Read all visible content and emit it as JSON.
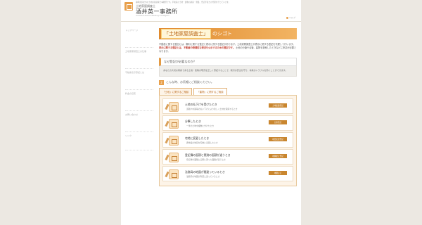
{
  "header": {
    "tagline": "静岡県浜松市の土地家屋調査士事務所です。不動産の土地・建物の調査・測量、登記手続きの代理を行っています。",
    "sub": "土地家屋調査士",
    "office_name": "酒井英一事務所",
    "office_en": "Licensed Land and Building Investigator",
    "help_label": "ヘルプ"
  },
  "sidebar": {
    "items": [
      {
        "label": "トップページ"
      },
      {
        "label": "土地家屋調査士の仕事"
      },
      {
        "label": "不動産表示登記とは"
      },
      {
        "label": "料金の目安"
      },
      {
        "label": "お問い合わせ"
      },
      {
        "label": "リンク"
      }
    ]
  },
  "main": {
    "title_highlight": "「土地家屋調査士」",
    "title_rest": "のシゴト",
    "intro": {
      "p1": "不動産に関する登記には、権利に関する登記と表示に関する登記があります。土地家屋調査士が表示に関する登記を代理して行います。",
      "p2_em": "表示に関する登記とは、不動産の物理的な現況を公示するための登記です。",
      "p3": "土地の分筆や合筆、建物を新築したときなどに申請が必要となります。"
    },
    "section_title": "なぜ登記が必要なのか？",
    "section_body": "あなたの大切な財産である土地・建物の現況を正しく登記することで、取引の安全を守り、将来のトラブルを防ぐことができます。",
    "consult_num": "2",
    "consult_text": "こんな時、お気軽にご相談ください。",
    "tabs": [
      {
        "label": "「土地」に関するご相談"
      },
      {
        "label": "「建物」に関するご相談"
      }
    ],
    "cards": [
      {
        "title": "土地の払下げを受けたとき",
        "desc": "道路や水路等の払い下げにより新しく土地を取得するとき",
        "badge": "土地表題登記"
      },
      {
        "title": "分筆したとき",
        "desc": "一筆の土地を複数に分けたとき",
        "badge": "分筆登記"
      },
      {
        "title": "宅地に変更したとき",
        "desc": "農地等の地目を宅地に変更したとき",
        "badge": "地目変更登記"
      },
      {
        "title": "登記簿の面積と実測の面積が違うとき",
        "desc": "登記簿の面積と実際に測った面積が違うとき",
        "badge": "地積更正登記"
      },
      {
        "title": "法務局の地図が間違っているとき",
        "desc": "法務局の地図が現況と違っているとき",
        "badge": "地図訂正"
      }
    ]
  }
}
